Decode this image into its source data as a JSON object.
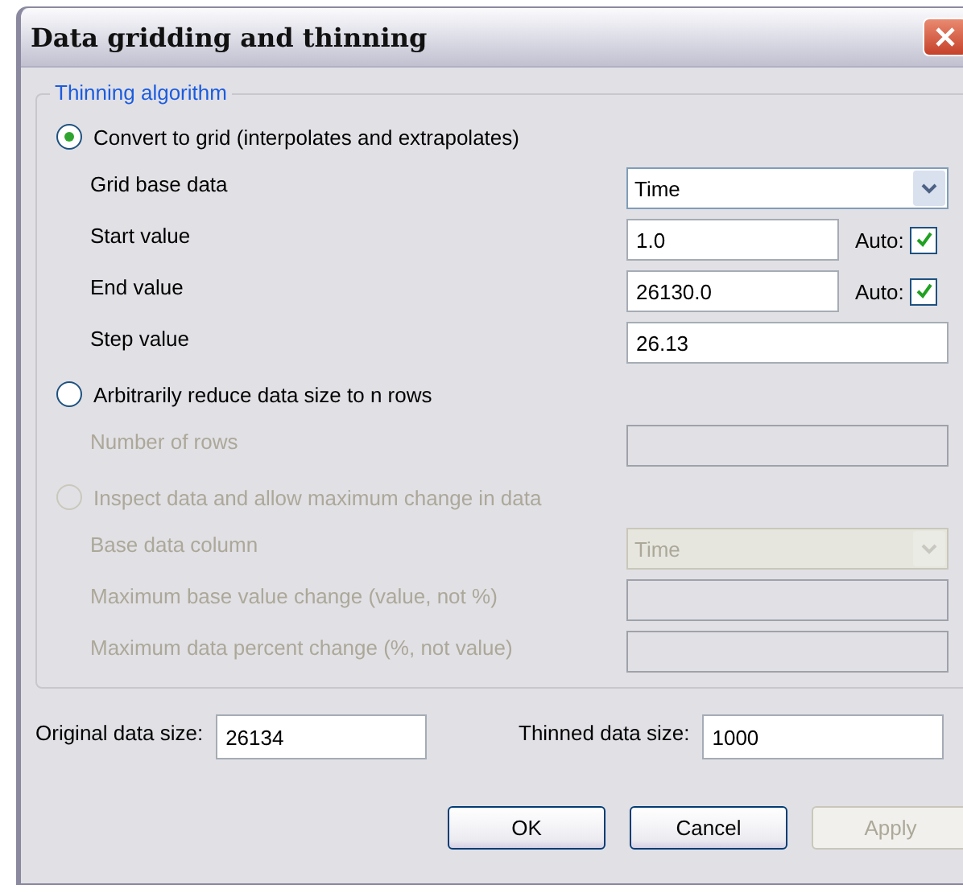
{
  "window": {
    "title": "Data gridding and thinning"
  },
  "group": {
    "title": "Thinning algorithm",
    "options": [
      {
        "label": "Convert to grid (interpolates and extrapolates)",
        "selected": true,
        "disabled": false,
        "rows": [
          {
            "kind": "dropdown",
            "label": "Grid base data",
            "value": "Time",
            "disabled": false
          },
          {
            "kind": "field",
            "label": "Start value",
            "value": "1.0",
            "disabled": false,
            "auto": {
              "label": "Auto:",
              "checked": true
            }
          },
          {
            "kind": "field",
            "label": "End value",
            "value": "26130.0",
            "disabled": false,
            "auto": {
              "label": "Auto:",
              "checked": true
            }
          },
          {
            "kind": "field",
            "label": "Step value",
            "value": "26.13",
            "disabled": false
          }
        ]
      },
      {
        "label": "Arbitrarily reduce data size to n rows",
        "selected": false,
        "disabled": false,
        "rows": [
          {
            "kind": "field",
            "label": "Number of rows",
            "disabled": true
          }
        ]
      },
      {
        "label": "Inspect data and allow maximum change in data",
        "selected": false,
        "disabled": true,
        "rows": [
          {
            "kind": "dropdown",
            "label": "Base data column",
            "value": "Time",
            "disabled": true
          },
          {
            "kind": "field",
            "label": "Maximum base value change (value, not %)",
            "disabled": true
          },
          {
            "kind": "field",
            "label": "Maximum data percent change (%, not value)",
            "disabled": true
          }
        ]
      }
    ]
  },
  "sizes": [
    {
      "label": "Original data size:",
      "value": "26134"
    },
    {
      "label": "Thinned data size:",
      "value": "1000"
    }
  ],
  "buttons": [
    {
      "label": "OK",
      "disabled": false
    },
    {
      "label": "Cancel",
      "disabled": false
    },
    {
      "label": "Apply",
      "disabled": true
    }
  ]
}
